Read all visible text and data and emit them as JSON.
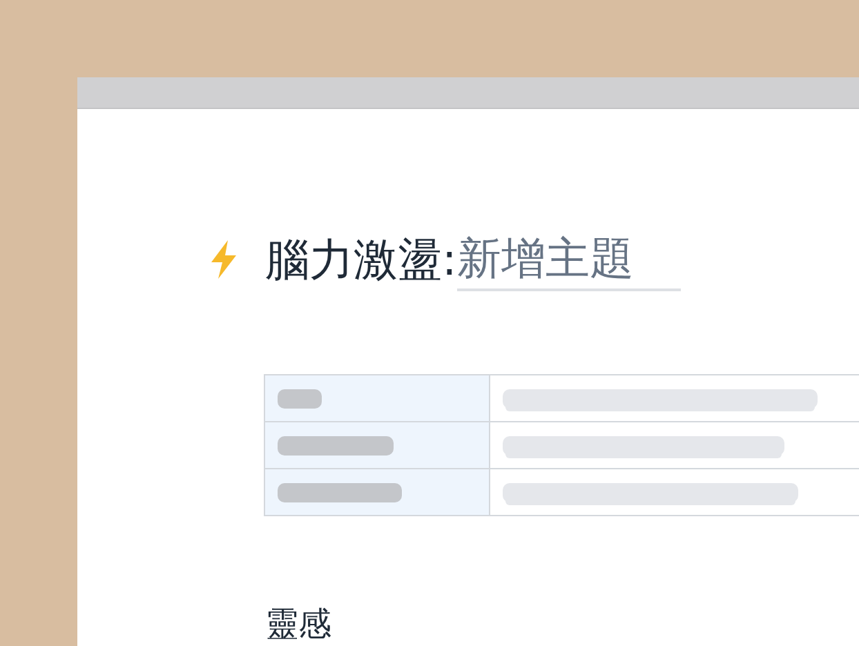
{
  "page": {
    "title": "腦力激盪",
    "separator": ":",
    "title_field": {
      "placeholder": "新增主題"
    }
  },
  "section_heading": "靈感"
}
